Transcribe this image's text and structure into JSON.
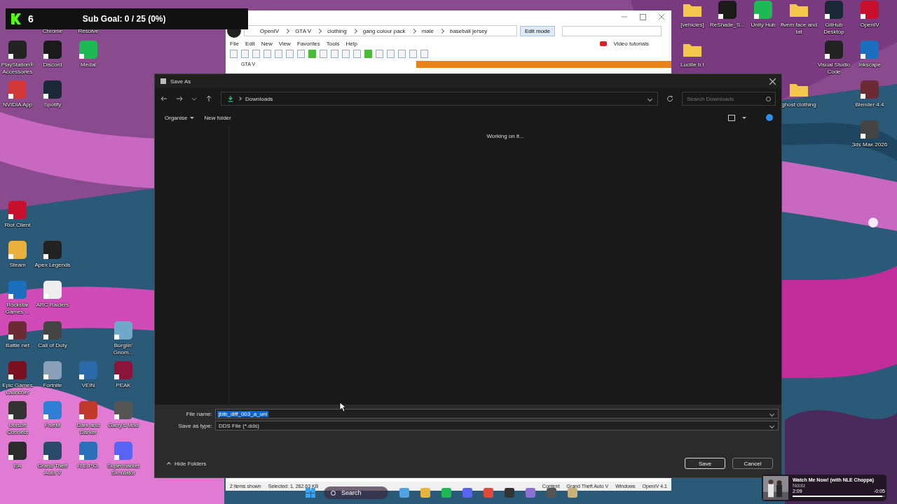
{
  "stream_overlay": {
    "count": "6",
    "goal": "Sub Goal: 0 / 25 (0%)"
  },
  "desktop_icons": [
    {
      "label": "Chrome",
      "kind": "label"
    },
    {
      "label": "Resolve",
      "kind": "label"
    },
    {
      "label": "PlayStation® Accessories",
      "kind": "app"
    },
    {
      "label": "Discord",
      "kind": "app"
    },
    {
      "label": "Medal",
      "kind": "app"
    },
    {
      "label": "NVIDIA App",
      "kind": "app"
    },
    {
      "label": "Spotify",
      "kind": "app"
    },
    {
      "label": "Riot Client",
      "kind": "app"
    },
    {
      "label": "Steam",
      "kind": "app"
    },
    {
      "label": "Apex Legends",
      "kind": "app"
    },
    {
      "label": "Rockstar Games ...",
      "kind": "app"
    },
    {
      "label": "ARC Raiders",
      "kind": "app"
    },
    {
      "label": "Battle.net",
      "kind": "app"
    },
    {
      "label": "Call of Duty",
      "kind": "app"
    },
    {
      "label": "Burglin' Gnom...",
      "kind": "app"
    },
    {
      "label": "Epic Games Launcher",
      "kind": "app"
    },
    {
      "label": "Fortnite",
      "kind": "app"
    },
    {
      "label": "VEIN",
      "kind": "app"
    },
    {
      "label": "PEAK",
      "kind": "app"
    },
    {
      "label": "Ubisoft Connect",
      "kind": "app"
    },
    {
      "label": "FiveM",
      "kind": "app"
    },
    {
      "label": "Dark and Darker",
      "kind": "app"
    },
    {
      "label": "Garry's Mod",
      "kind": "app"
    },
    {
      "label": "EA",
      "kind": "app"
    },
    {
      "label": "Grand Theft Auto V",
      "kind": "app"
    },
    {
      "label": "R.E.P.O.",
      "kind": "app"
    },
    {
      "label": "Supermarket Simulator",
      "kind": "app"
    },
    {
      "label": "[vehicles]",
      "kind": "folder"
    },
    {
      "label": "ReShade_S...",
      "kind": "app"
    },
    {
      "label": "Unity Hub",
      "kind": "app"
    },
    {
      "label": "fivem face and tat",
      "kind": "folder"
    },
    {
      "label": "GitHub Desktop",
      "kind": "app"
    },
    {
      "label": "OpenIV",
      "kind": "app"
    },
    {
      "label": "Lucille b.t",
      "kind": "folder"
    },
    {
      "label": "Visual Studio Code",
      "kind": "app"
    },
    {
      "label": "Inkscape",
      "kind": "app"
    },
    {
      "label": "ghost clothing",
      "kind": "folder"
    },
    {
      "label": "Blender 4.4",
      "kind": "app"
    },
    {
      "label": "3ds Max 2026",
      "kind": "app"
    }
  ],
  "openiv_window": {
    "breadcrumb": [
      "OpenIV",
      "GTA V",
      "clothing",
      "gang colour pack",
      "male",
      "baseball jersey"
    ],
    "edit_mode": "Edit mode",
    "menu": [
      "File",
      "Edit",
      "New",
      "View",
      "Favorites",
      "Tools",
      "Help"
    ],
    "video_tutorials": "Video tutorials",
    "tree_item": "GTA V",
    "status": [
      "2 items shown",
      "Selected: 1,  262.63 KB",
      "Content",
      "Grand Theft Auto V",
      "Windows",
      "OpenIV 4.1"
    ]
  },
  "save_dialog": {
    "title": "Save As",
    "location": "Downloads",
    "search": {
      "placeholder": "Search Downloads"
    },
    "toolbar": [
      "Organise",
      "New folder"
    ],
    "message": "Working on it...",
    "fields": [
      {
        "label": "File name:",
        "value": "jbib_diff_003_a_uni",
        "selected": true
      },
      {
        "label": "Save as type:",
        "value": "DDS File (*.dds)",
        "selected": false
      }
    ],
    "hide_folders": "Hide Folders",
    "buttons": [
      "Save",
      "Cancel"
    ]
  },
  "taskbar": {
    "search": "Search"
  },
  "media": {
    "title": "Watch Me Now! (with NLE Choppa)",
    "artist": "Ndotz",
    "elapsed": "2:09",
    "remaining": "-0:05",
    "level": 0.97
  }
}
